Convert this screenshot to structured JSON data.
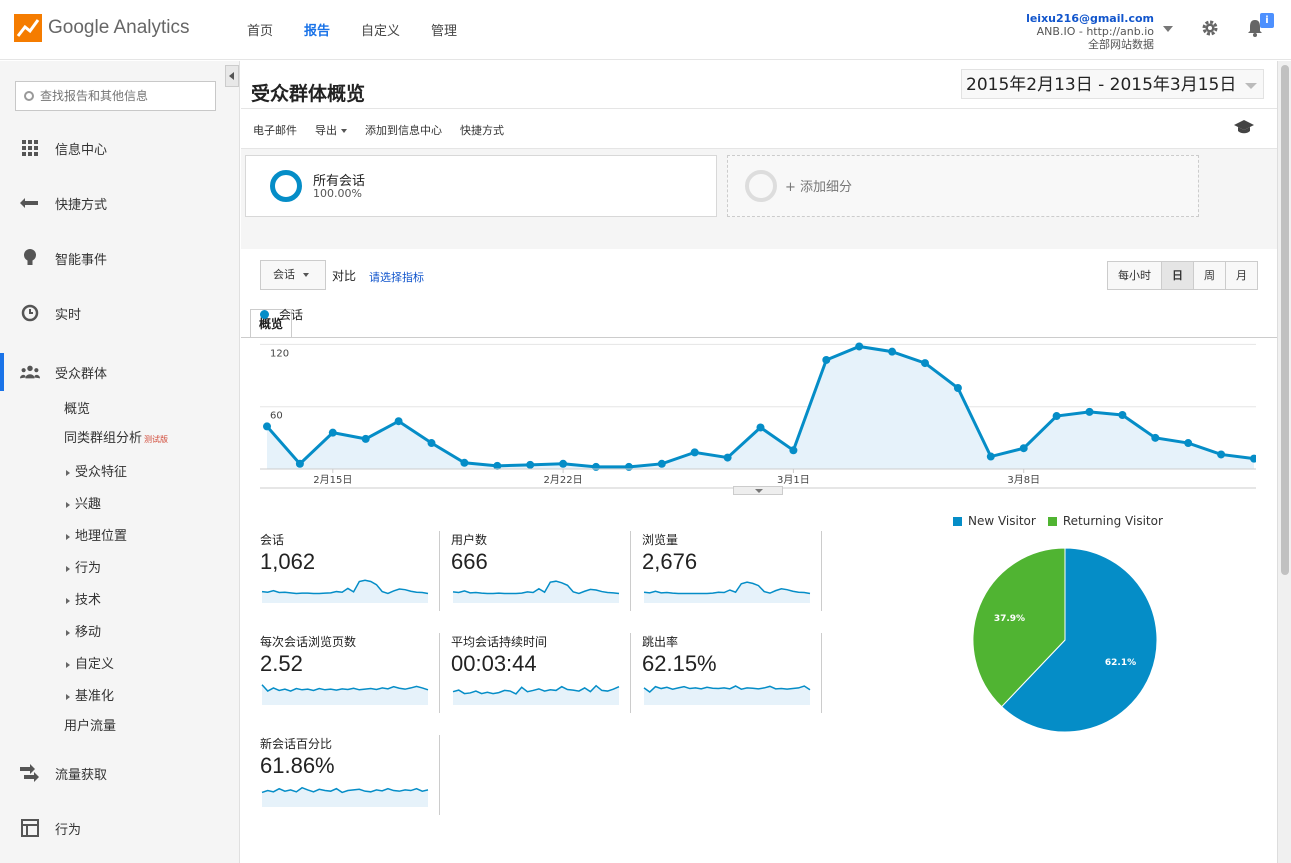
{
  "app": {
    "logo_text": "Google Analytics"
  },
  "topnav": [
    {
      "label": "首页",
      "active": false
    },
    {
      "label": "报告",
      "active": true
    },
    {
      "label": "自定义",
      "active": false
    },
    {
      "label": "管理",
      "active": false
    }
  ],
  "account": {
    "email": "leixu216@gmail.com",
    "property": "ANB.IO - http://anb.io",
    "view": "全部网站数据",
    "notifications": "i"
  },
  "sidebar": {
    "search_placeholder": "查找报告和其他信息",
    "items": [
      {
        "label": "信息中心",
        "icon": "dashboard-icon"
      },
      {
        "label": "快捷方式",
        "icon": "shortcut-icon"
      },
      {
        "label": "智能事件",
        "icon": "lightbulb-icon"
      },
      {
        "label": "实时",
        "icon": "clock-icon"
      },
      {
        "label": "受众群体",
        "icon": "people-icon"
      },
      {
        "label": "流量获取",
        "icon": "acquisition-icon"
      },
      {
        "label": "行为",
        "icon": "behavior-icon"
      }
    ],
    "audience_sub": {
      "overview": "概览",
      "cohort": "同类群组分析",
      "cohort_badge": "测试版",
      "expandable": [
        "受众特征",
        "兴趣",
        "地理位置",
        "行为",
        "技术",
        "移动",
        "自定义",
        "基准化"
      ],
      "user_flow": "用户流量"
    }
  },
  "report": {
    "title": "受众群体概览",
    "date_range": "2015年2月13日 - 2015年3月15日",
    "toolbar": {
      "email": "电子邮件",
      "export": "导出",
      "add_dashboard": "添加到信息中心",
      "shortcut": "快捷方式"
    },
    "segments": {
      "all_name": "所有会话",
      "all_pct": "100.00%",
      "add_label": "+ 添加细分"
    },
    "tab": "概览",
    "metric_select": "会话",
    "vs_label": "对比",
    "pick_metric": "请选择指标",
    "granularity": [
      {
        "label": "每小时",
        "active": false
      },
      {
        "label": "日",
        "active": true
      },
      {
        "label": "周",
        "active": false
      },
      {
        "label": "月",
        "active": false
      }
    ],
    "chart_legend": "会话"
  },
  "chart_data": [
    {
      "type": "area",
      "series": [
        {
          "name": "会话",
          "color": "#058dc7",
          "values": [
            41,
            5,
            35,
            29,
            46,
            25,
            6,
            3,
            4,
            5,
            2,
            2,
            5,
            16,
            11,
            40,
            18,
            105,
            118,
            113,
            102,
            78,
            12,
            20,
            51,
            55,
            52,
            30,
            25,
            14,
            10
          ]
        }
      ],
      "x_ticks": [
        {
          "index": 2,
          "label": "2月15日"
        },
        {
          "index": 9,
          "label": "2月22日"
        },
        {
          "index": 16,
          "label": "3月1日"
        },
        {
          "index": 23,
          "label": "3月8日"
        }
      ],
      "y_ticks": [
        "60",
        "120"
      ],
      "ylim": [
        0,
        130
      ],
      "grid": true
    },
    {
      "type": "pie",
      "slices": [
        {
          "name": "New Visitor",
          "value": 62.1,
          "label": "62.1%",
          "color": "#058dc7"
        },
        {
          "name": "Returning Visitor",
          "value": 37.9,
          "label": "37.9%",
          "color": "#50b432"
        }
      ],
      "legend": "top"
    }
  ],
  "stats": [
    {
      "label": "会话",
      "value": "1,062",
      "spark": [
        30,
        28,
        33,
        27,
        28,
        26,
        24,
        25,
        25,
        24,
        24,
        25,
        26,
        30,
        28,
        40,
        29,
        62,
        66,
        62,
        52,
        30,
        24,
        32,
        38,
        36,
        31,
        28,
        27,
        24
      ]
    },
    {
      "label": "用户数",
      "value": "666",
      "spark": [
        29,
        27,
        32,
        26,
        27,
        25,
        24,
        24,
        25,
        24,
        24,
        24,
        25,
        29,
        27,
        39,
        28,
        60,
        63,
        58,
        50,
        29,
        24,
        31,
        37,
        35,
        30,
        27,
        26,
        24
      ]
    },
    {
      "label": "浏览量",
      "value": "2,676",
      "spark": [
        28,
        26,
        31,
        26,
        27,
        25,
        24,
        24,
        24,
        24,
        24,
        24,
        25,
        28,
        27,
        35,
        28,
        55,
        60,
        56,
        49,
        30,
        25,
        33,
        39,
        36,
        31,
        28,
        27,
        24
      ]
    },
    {
      "label": "每次会话浏览页数",
      "value": "2.52",
      "spark": [
        58,
        38,
        48,
        40,
        44,
        38,
        46,
        42,
        44,
        40,
        46,
        42,
        44,
        41,
        45,
        43,
        47,
        42,
        44,
        46,
        43,
        48,
        45,
        52,
        47,
        44,
        48,
        53,
        48,
        42
      ]
    },
    {
      "label": "平均会话持续时间",
      "value": "00:03:44",
      "spark": [
        36,
        41,
        30,
        32,
        38,
        30,
        34,
        30,
        33,
        40,
        38,
        29,
        50,
        36,
        40,
        45,
        38,
        42,
        40,
        52,
        43,
        41,
        38,
        48,
        36,
        55,
        40,
        38,
        44,
        52
      ]
    },
    {
      "label": "跳出率",
      "value": "62.15%",
      "spark": [
        48,
        35,
        52,
        46,
        50,
        44,
        48,
        52,
        46,
        48,
        45,
        50,
        47,
        46,
        48,
        45,
        54,
        44,
        48,
        47,
        45,
        48,
        53,
        45,
        46,
        44,
        46,
        48,
        54,
        42
      ]
    },
    {
      "label": "新会话百分比",
      "value": "61.86%",
      "spark": [
        40,
        46,
        42,
        52,
        44,
        48,
        42,
        55,
        48,
        42,
        50,
        46,
        44,
        52,
        40,
        46,
        48,
        50,
        44,
        42,
        48,
        45,
        52,
        46,
        44,
        48,
        46,
        52,
        44,
        48
      ]
    }
  ]
}
